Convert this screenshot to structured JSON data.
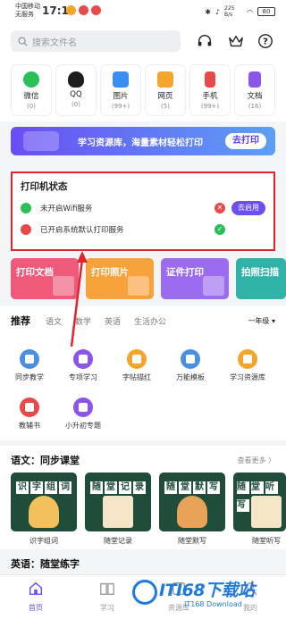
{
  "status_bar": {
    "carrier_line1": "中国移动",
    "carrier_line2": "无服务",
    "time": "17:13",
    "net_speed": "225 B/s",
    "battery": "80"
  },
  "search": {
    "placeholder": "搜索文件名"
  },
  "quick_items": [
    {
      "label": "微信",
      "count": "(0)",
      "color": "#2bbf5a",
      "icon": "wechat-icon"
    },
    {
      "label": "QQ",
      "count": "(0)",
      "color": "#1e1e1e",
      "icon": "qq-icon"
    },
    {
      "label": "图片",
      "count": "(99+)",
      "color": "#3a8ef0",
      "icon": "image-icon"
    },
    {
      "label": "网页",
      "count": "(5)",
      "color": "#f4a52b",
      "icon": "webpage-icon"
    },
    {
      "label": "手机",
      "count": "(99+)",
      "color": "#e84a4a",
      "icon": "phone-icon"
    },
    {
      "label": "文档",
      "count": "(16)",
      "color": "#8b55e8",
      "icon": "document-icon"
    }
  ],
  "banner": {
    "text": "学习资源库，海量素材轻松打印",
    "button": "去打印"
  },
  "printer_status": {
    "title": "打印机状态",
    "rows": [
      {
        "text": "未开启Wifi服务",
        "state": "error",
        "action": "去启用",
        "icon_color": "#2bbf5a"
      },
      {
        "text": "已开启系统默认打印服务",
        "state": "ok",
        "icon_color": "#e84a4a"
      }
    ]
  },
  "functions": [
    {
      "label": "打印文档",
      "color": "#ef5a7a"
    },
    {
      "label": "打印照片",
      "color": "#f7a23a"
    },
    {
      "label": "证件打印",
      "color": "#9b6cf0"
    },
    {
      "label": "拍照扫描",
      "color": "#2fb2a8"
    }
  ],
  "recommend": {
    "tabs": [
      "推荐",
      "语文",
      "数学",
      "英语",
      "生活办公"
    ],
    "grade": "一年级 ▾",
    "items": [
      {
        "label": "同步教学",
        "color": "#4a90e2"
      },
      {
        "label": "专项学习",
        "color": "#8b55e8"
      },
      {
        "label": "字帖描红",
        "color": "#f4a52b"
      },
      {
        "label": "万能模板",
        "color": "#4a90e2"
      },
      {
        "label": "学习资源库",
        "color": "#f4a52b"
      },
      {
        "label": "教辅书",
        "color": "#e84a4a"
      },
      {
        "label": "小升初专题",
        "color": "#8b55e8"
      }
    ]
  },
  "classroom": {
    "title": "语文：同步课堂",
    "more": "查看更多 〉",
    "cards": [
      {
        "header": [
          "识",
          "字",
          "组",
          "词"
        ],
        "label": "识字组词"
      },
      {
        "header": [
          "随",
          "堂",
          "记",
          "录"
        ],
        "label": "随堂记录"
      },
      {
        "header": [
          "随",
          "堂",
          "默",
          "写"
        ],
        "label": "随堂默写"
      },
      {
        "header": [
          "随",
          "堂",
          "听",
          "写"
        ],
        "label": "随堂听写"
      }
    ]
  },
  "english_section_title": "英语：随堂练字",
  "bottom_nav": [
    {
      "label": "首页",
      "active": true
    },
    {
      "label": "学习",
      "active": false
    },
    {
      "label": "资源库",
      "active": false
    },
    {
      "label": "我的",
      "active": false
    }
  ],
  "watermark": {
    "text": "ITI68下载站",
    "sub": "IT168 Download"
  },
  "colors": {
    "accent": "#6c4ef2",
    "highlight_border": "#e0262c"
  }
}
